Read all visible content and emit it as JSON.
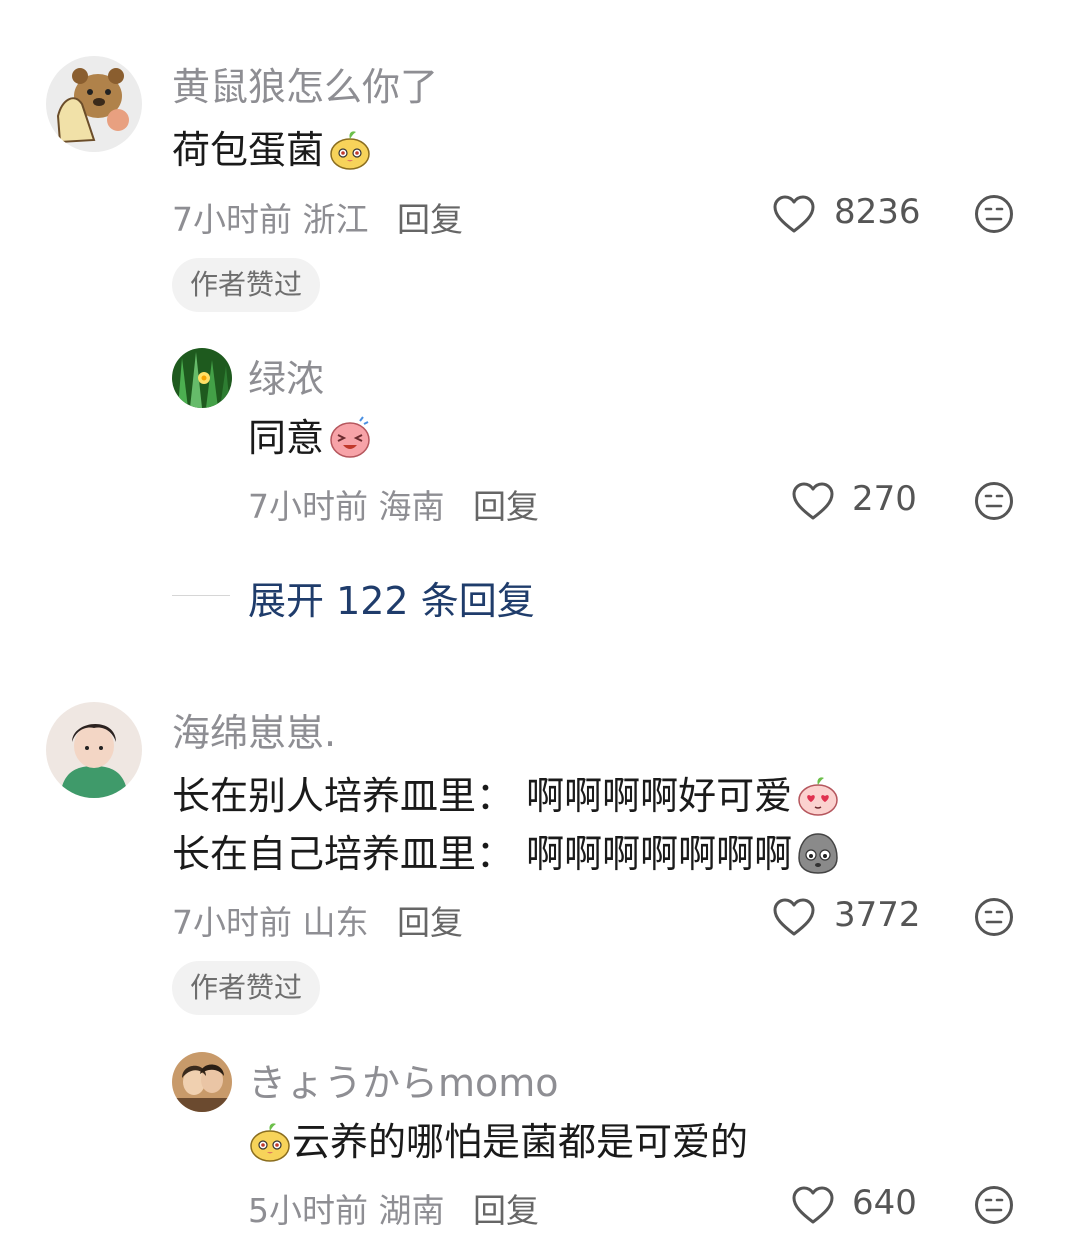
{
  "comments": [
    {
      "username": "黄鼠狼怎么你了",
      "content": "荷包蛋菌",
      "content_emoji": "sprout-blob-emoji",
      "time": "7小时前",
      "location": "浙江",
      "reply_label": "回复",
      "likes": "8236",
      "badge": "作者赞过",
      "sub_reply": {
        "username": "绿浓",
        "content": "同意",
        "content_emoji": "laughing-blob-emoji",
        "time": "7小时前",
        "location": "海南",
        "reply_label": "回复",
        "likes": "270"
      },
      "expand_label": "展开 122 条回复"
    },
    {
      "username": "海绵崽崽.",
      "content_line1": "长在别人培养皿里： 啊啊啊啊好可爱",
      "content_line2": "长在自己培养皿里： 啊啊啊啊啊啊啊",
      "time": "7小时前",
      "location": "山东",
      "reply_label": "回复",
      "likes": "3772",
      "badge": "作者赞过",
      "sub_reply": {
        "username": "きょうからmomo",
        "content": "云养的哪怕是菌都是可爱的",
        "content_emoji": "sprout-blob-emoji",
        "time": "5小时前",
        "location": "湖南",
        "reply_label": "回复",
        "likes": "640"
      }
    }
  ],
  "colors": {
    "username": "#8e8e93",
    "content": "#1a1a1a",
    "expand_link": "#1f3c6b",
    "badge_bg": "#f2f2f2"
  }
}
